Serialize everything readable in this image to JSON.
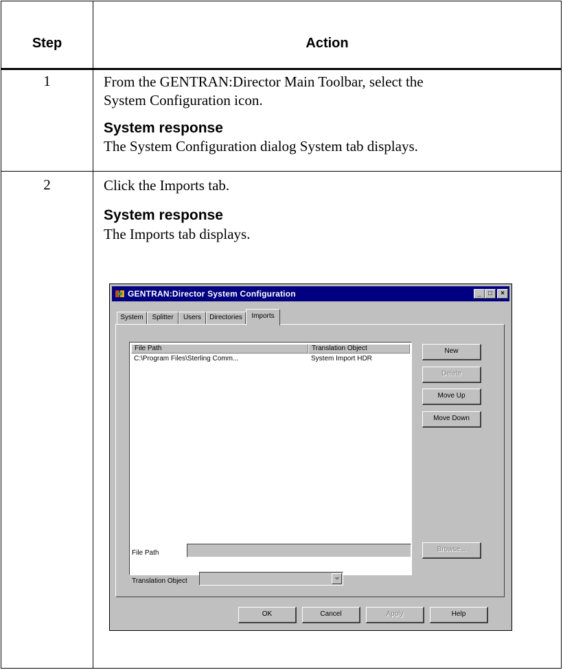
{
  "table": {
    "headers": {
      "step": "Step",
      "action": "Action"
    },
    "rows": [
      {
        "step": "1",
        "action_lines": [
          "From the GENTRAN:Director Main Toolbar, select the",
          "System Configuration icon."
        ],
        "response_heading": "System response",
        "response_text": "The System Configuration dialog System tab displays."
      },
      {
        "step": "2",
        "action_lines": [
          "Click the Imports tab."
        ],
        "response_heading": "System response",
        "response_text": "The Imports tab displays."
      }
    ]
  },
  "dialog": {
    "title": "GENTRAN:Director System Configuration",
    "window_buttons": {
      "minimize": "_",
      "maximize": "□",
      "close": "×"
    },
    "tabs": [
      "System",
      "Splitter",
      "Users",
      "Directories",
      "Imports"
    ],
    "active_tab": "Imports",
    "list": {
      "columns": [
        "File Path",
        "Translation Object"
      ],
      "rows": [
        [
          "C:\\Program Files\\Sterling Comm...",
          "System Import HDR"
        ]
      ]
    },
    "side_buttons": {
      "new": "New",
      "delete": "Delete",
      "move_up": "Move Up",
      "move_down": "Move Down"
    },
    "file_path_label": "File Path",
    "file_path_value": "",
    "browse_button": "Browse...",
    "translation_object_label": "Translation Object",
    "translation_object_value": "",
    "bottom_buttons": {
      "ok": "OK",
      "cancel": "Cancel",
      "apply": "Apply",
      "help": "Help"
    },
    "colors": {
      "title_bar": "#000080",
      "face": "#c0c0c0",
      "disabled_text": "#808080"
    }
  }
}
